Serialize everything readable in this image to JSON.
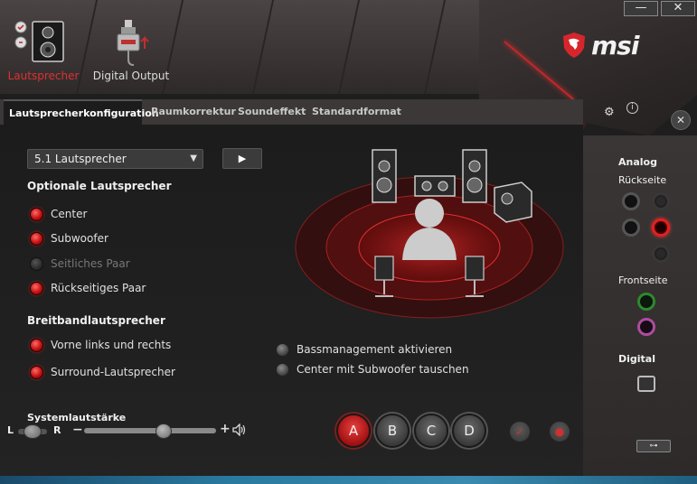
{
  "window": {
    "minimize_label": "—",
    "close_label": "✕"
  },
  "brand": {
    "logo_text": "msi",
    "accent": "#c0282a"
  },
  "devices": [
    {
      "label": "Lautsprecher",
      "active": true
    },
    {
      "label": "Digital Output",
      "active": false
    }
  ],
  "tabs": [
    {
      "label": "Lautsprecherkonfiguration",
      "active": true
    },
    {
      "label": "Raumkorrektur",
      "active": false
    },
    {
      "label": "Soundeffekt",
      "active": false
    },
    {
      "label": "Standardformat",
      "active": false
    }
  ],
  "config": {
    "speaker_select": "5.1 Lautsprecher",
    "play_label": "▶",
    "optional_title": "Optionale Lautsprecher",
    "optional": [
      {
        "label": "Center",
        "on": true,
        "enabled": true
      },
      {
        "label": "Subwoofer",
        "on": true,
        "enabled": true
      },
      {
        "label": "Seitliches Paar",
        "on": false,
        "enabled": false
      },
      {
        "label": "Rückseitiges Paar",
        "on": true,
        "enabled": true
      }
    ],
    "fullrange_title": "Breitbandlautsprecher",
    "fullrange": [
      {
        "label": "Vorne links und rechts",
        "on": true
      },
      {
        "label": "Surround-Lautsprecher",
        "on": true
      }
    ],
    "bass_management": "Bassmanagement aktivieren",
    "swap_center_sub": "Center mit Subwoofer tauschen"
  },
  "volume": {
    "label": "Systemlautstärke",
    "left": "L",
    "right": "R",
    "minus": "−",
    "plus": "+",
    "level": 0.6,
    "balance": 0.5
  },
  "presets": [
    {
      "label": "A",
      "active": true
    },
    {
      "label": "B",
      "active": false
    },
    {
      "label": "C",
      "active": false
    },
    {
      "label": "D",
      "active": false
    }
  ],
  "sidebar": {
    "analog_title": "Analog",
    "rear_title": "Rückseite",
    "front_title": "Frontseite",
    "digital_title": "Digital"
  }
}
